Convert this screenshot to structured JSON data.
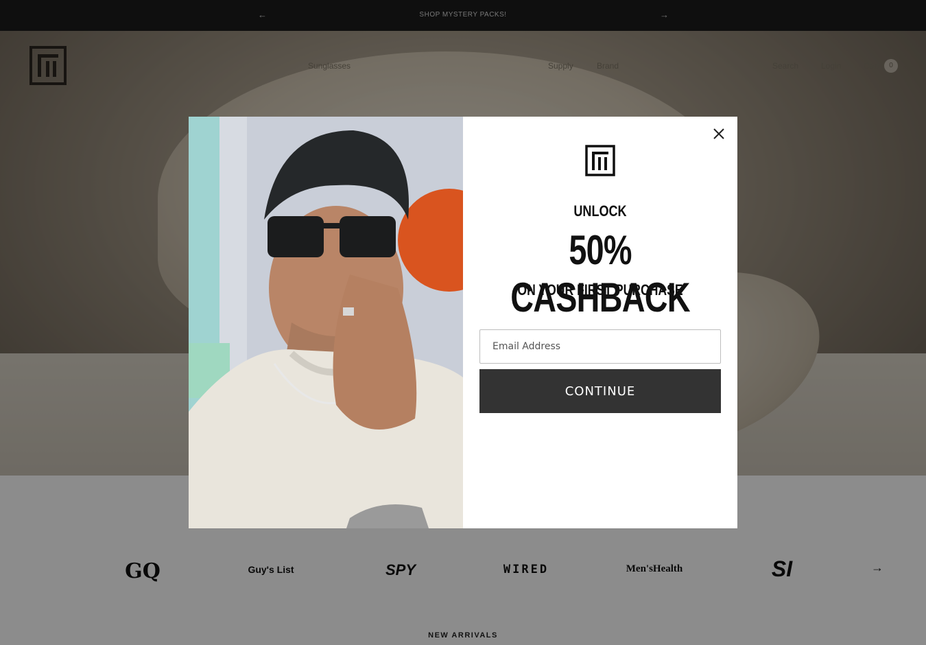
{
  "announcement": {
    "text": "SHOP MYSTERY PACKS!",
    "prev_icon": "arrow-left-icon",
    "next_icon": "arrow-right-icon"
  },
  "nav": {
    "sunglasses": "Sunglasses",
    "supply": "Supply",
    "brand": "Brand",
    "search": "Search",
    "login": "Login",
    "cart": "Cart",
    "cart_count": "0"
  },
  "popup": {
    "unlock": "UNLOCK",
    "headline": "50% CASHBACK",
    "subheadline": "ON YOUR FIRST PURCHASE",
    "email_placeholder": "Email Address",
    "button": "CONTINUE",
    "close_icon": "close-icon"
  },
  "press": {
    "logos": [
      "GQ",
      "Guy's List",
      "SPY",
      "WIRED",
      "Men'sHealth",
      "SI"
    ],
    "next_icon": "arrow-right-icon"
  },
  "sections": {
    "new_arrivals": "NEW ARRIVALS"
  },
  "colors": {
    "button": "#333333",
    "announcement_bg": "#1c1c1c",
    "overlay": "rgba(0,0,0,0.45)"
  }
}
